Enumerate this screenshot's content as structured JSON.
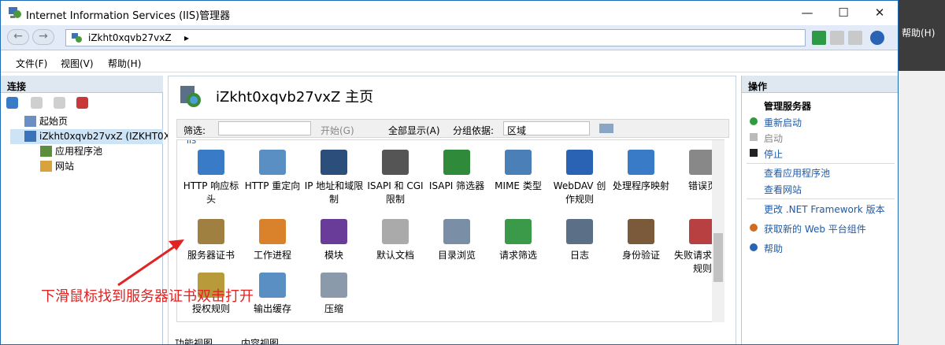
{
  "window": {
    "title": "Internet Information Services (IIS)管理器",
    "controls": [
      "—",
      "☐",
      "✕"
    ]
  },
  "address": {
    "segments": [
      "iZkht0xqvb27vxZ",
      "▸"
    ]
  },
  "menu": [
    "文件(F)",
    "视图(V)",
    "帮助(H)"
  ],
  "connections": {
    "header": "连接",
    "tree": [
      {
        "label": "起始页"
      },
      {
        "label": "iZkht0xqvb27vxZ (IZKHT0X"
      },
      {
        "label": "应用程序池"
      },
      {
        "label": "网站"
      }
    ]
  },
  "center": {
    "title": "iZkht0xqvb27vxZ 主页",
    "filter": {
      "label": "筛选:",
      "start": "开始(G)",
      "show_all": "全部显示(A)",
      "group_label": "分组依据:",
      "group_value": "区域",
      "section": "IIS"
    },
    "features": [
      [
        "HTTP 响应标头",
        "HTTP 重定向",
        "IP 地址和域限制",
        "ISAPI 和 CGI 限制",
        "ISAPI 筛选器",
        "MIME 类型",
        "WebDAV 创作规则",
        "处理程序映射",
        "错误页"
      ],
      [
        "服务器证书",
        "工作进程",
        "模块",
        "默认文档",
        "目录浏览",
        "请求筛选",
        "日志",
        "身份验证",
        "失败请求跟踪规则"
      ],
      [
        "授权规则",
        "输出缓存",
        "压缩"
      ]
    ],
    "tabs": [
      "功能视图",
      "内容视图"
    ]
  },
  "actions": {
    "header": "操作",
    "manage_server": "管理服务器",
    "restart": "重新启动",
    "start": "启动",
    "stop": "停止",
    "view_app_pools": "查看应用程序池",
    "view_sites": "查看网站",
    "change_net": "更改 .NET Framework 版本",
    "get_web_platform": "获取新的 Web 平台组件",
    "help": "帮助"
  },
  "background_window": {
    "menu_help": "帮助(H)"
  },
  "annotation": "下滑鼠标找到服务器证书双击打开",
  "colors": {
    "accent": "#1f5aa6",
    "annotation": "#e02323",
    "selection": "#cde4f7"
  }
}
